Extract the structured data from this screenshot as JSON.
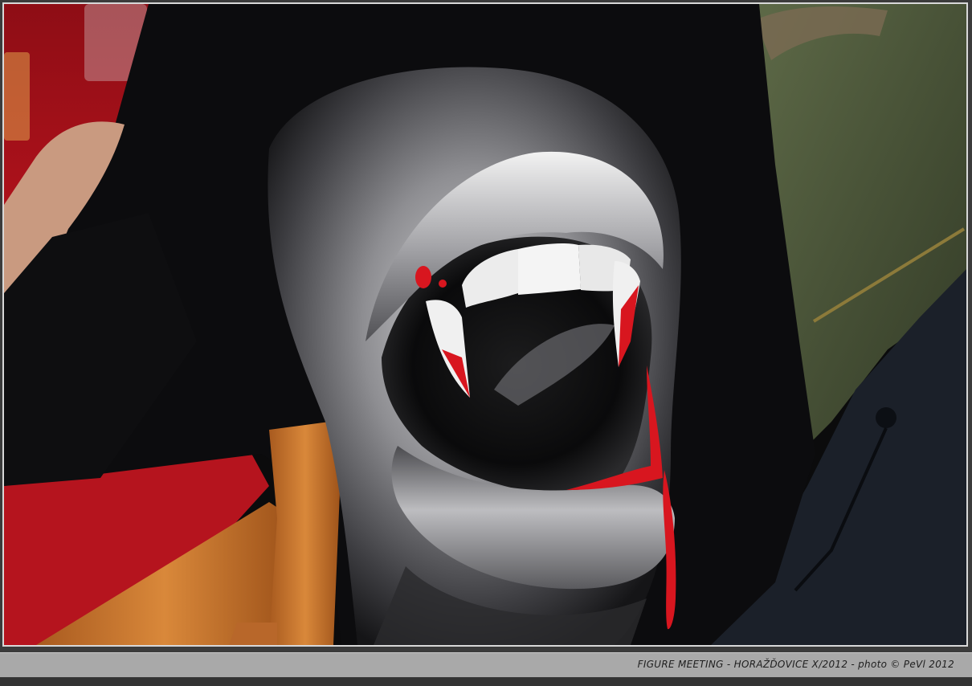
{
  "caption": "FIGURE MEETING - HORAŽĎOVICE X/2012 - photo © PeVl 2012",
  "photo": {
    "subject": "",
    "colors": {
      "shirt": "#0c0c0e",
      "tablecloth": "#b3121c",
      "chair": "#c8742e",
      "jacket": "#4f5a3c",
      "blood": "#d8161f",
      "teeth": "#eaeaea",
      "lips": "#8d8d8f"
    }
  }
}
